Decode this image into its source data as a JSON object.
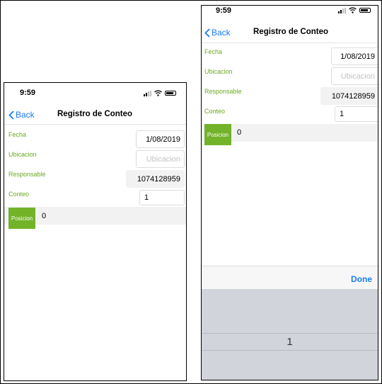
{
  "status": {
    "time": "9:59"
  },
  "nav": {
    "back_label": "Back",
    "title": "Registro de Conteo"
  },
  "form": {
    "fecha": {
      "label": "Fecha",
      "value": "1/08/2019"
    },
    "ubicacion": {
      "label": "Ubicacion",
      "placeholder": "Ubicacion"
    },
    "responsable": {
      "label": "Responsable",
      "value": "1074128959"
    },
    "conteo": {
      "label": "Conteo",
      "value": "1"
    }
  },
  "posicion": {
    "button_label": "Posicion",
    "value": "0"
  },
  "picker": {
    "done_label": "Done",
    "selected": "1"
  },
  "colors": {
    "accent": "#1a7cf5",
    "label_green": "#6aa820",
    "button_green": "#72b32a"
  },
  "icons": [
    "chevron-left-icon",
    "signal-icon",
    "wifi-icon",
    "battery-icon"
  ]
}
